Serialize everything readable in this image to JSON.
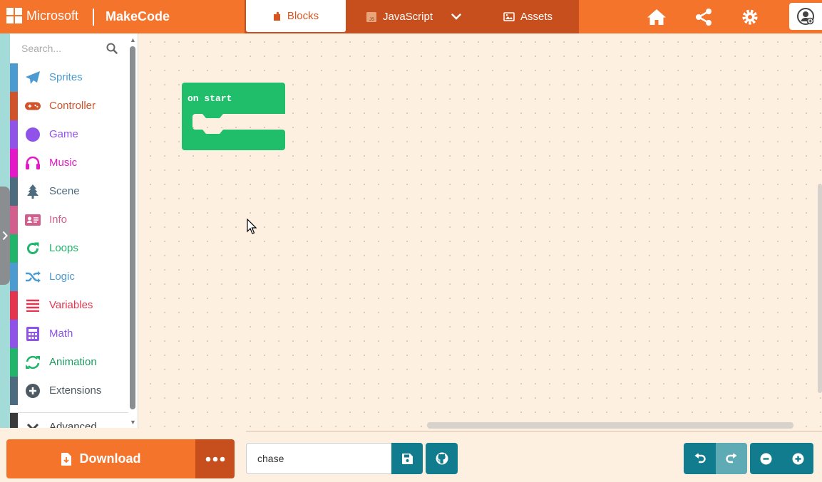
{
  "header": {
    "brand": "Microsoft",
    "app_name": "MakeCode",
    "tabs": [
      {
        "label": "Blocks",
        "icon": "puzzle-icon",
        "active": true
      },
      {
        "label": "JavaScript",
        "icon": "js-file-icon",
        "active": false
      },
      {
        "label": "Assets",
        "icon": "image-icon",
        "active": false
      }
    ],
    "actions": [
      "home-icon",
      "share-icon",
      "settings-icon",
      "user-icon"
    ]
  },
  "toolbox": {
    "search_placeholder": "Search...",
    "categories": [
      {
        "label": "Sprites",
        "color": "#4b9bd1",
        "icon": "paper-plane-icon"
      },
      {
        "label": "Controller",
        "color": "#d1532a",
        "icon": "gamepad-icon"
      },
      {
        "label": "Game",
        "color": "#8f53ea",
        "icon": "circle-icon"
      },
      {
        "label": "Music",
        "color": "#e418c6",
        "icon": "headphones-icon"
      },
      {
        "label": "Scene",
        "color": "#4d6b7f",
        "icon": "tree-icon"
      },
      {
        "label": "Info",
        "color": "#d15e8d",
        "icon": "id-card-icon"
      },
      {
        "label": "Loops",
        "color": "#20b56a",
        "icon": "refresh-icon"
      },
      {
        "label": "Logic",
        "color": "#4b9bd1",
        "icon": "shuffle-icon"
      },
      {
        "label": "Variables",
        "color": "#e5344e",
        "icon": "list-icon"
      },
      {
        "label": "Math",
        "color": "#8f53ea",
        "icon": "calculator-icon"
      },
      {
        "label": "Animation",
        "color": "#20b56a",
        "icon": "sync-icon"
      },
      {
        "label": "Extensions",
        "color": "#4d6b7f",
        "icon": "plus-circle-icon"
      },
      {
        "label": "Advanced",
        "color": "#3a3a3a",
        "icon": "chevron-down-icon"
      }
    ]
  },
  "workspace": {
    "block_label": "on start",
    "block_color": "#20bd6a"
  },
  "footer": {
    "download_label": "Download",
    "project_name": "chase"
  },
  "colors": {
    "accent": "#f5742c",
    "accent_dark": "#c64f1d",
    "teal": "#107c8d"
  }
}
